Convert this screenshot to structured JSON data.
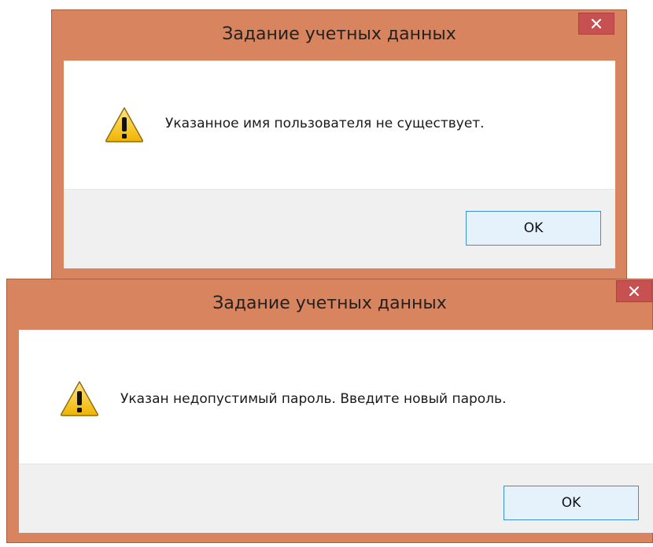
{
  "dialogs": [
    {
      "title": "Задание учетных данных",
      "message": "Указанное имя пользователя не существует.",
      "ok_label": "OK",
      "close_glyph": "×",
      "icon": "warning-icon"
    },
    {
      "title": "Задание учетных данных",
      "message": "Указан недопустимый пароль. Введите новый пароль.",
      "ok_label": "OK",
      "close_glyph": "×",
      "icon": "warning-icon"
    }
  ],
  "colors": {
    "frame": "#d7845f",
    "close_button": "#c75050",
    "footer": "#f0f0f0",
    "ok_border": "#3c8ed8",
    "warning_fill": "#f5c518"
  }
}
